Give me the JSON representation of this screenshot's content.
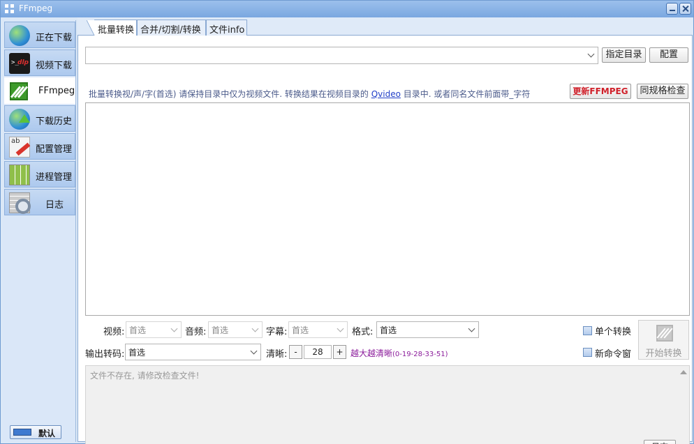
{
  "window": {
    "title": "FFmpeg"
  },
  "sidebar": {
    "items": [
      {
        "label": "正在下载",
        "icon": "globe-link-icon",
        "active": false
      },
      {
        "label": "视频下载",
        "icon": "terminal-dlp-icon",
        "active": false
      },
      {
        "label": "FFmpeg",
        "icon": "ffmpeg-icon",
        "active": true
      },
      {
        "label": "下载历史",
        "icon": "globe-upload-icon",
        "active": false
      },
      {
        "label": "配置管理",
        "icon": "edit-pencil-icon",
        "active": false
      },
      {
        "label": "进程管理",
        "icon": "grid-table-icon",
        "active": false
      },
      {
        "label": "日志",
        "icon": "log-gear-icon",
        "active": false
      }
    ],
    "default_button": "默认"
  },
  "tabs": [
    {
      "label": "批量转换",
      "active": true
    },
    {
      "label": "合并/切割/转换",
      "active": false
    },
    {
      "label": "文件info",
      "active": false
    }
  ],
  "toolbar": {
    "directory_value": "",
    "specify_dir_button": "指定目录",
    "config_button": "配置",
    "update_button": "更新FFMPEG",
    "spec_check_button": "同规格检查"
  },
  "hint": {
    "before": "批量转换视/声/字(首选) 请保持目录中仅为视频文件. 转换结果在视频目录的 ",
    "link": "Qvideo",
    "after": " 目录中. 或者同名文件前面带_字符"
  },
  "options": {
    "video_label": "视频:",
    "video_value": "首选",
    "audio_label": "音频:",
    "audio_value": "首选",
    "subtitle_label": "字幕:",
    "subtitle_value": "首选",
    "format_label": "格式:",
    "format_value": "首选",
    "output_codec_label": "输出转码:",
    "output_codec_value": "首选",
    "clarity_label": "清晰:",
    "clarity_minus": "-",
    "clarity_value": "28",
    "clarity_plus": "+",
    "quality_hint": "越大越清晰",
    "quality_range": "(0-19-28-33-51)",
    "single_convert_label": "单个转换",
    "new_cmd_window_label": "新命令窗",
    "start_button": "开始转换"
  },
  "log": {
    "message": "文件不存在, 请修改检查文件!",
    "log_button": "日志"
  },
  "colors": {
    "accent": "#7aa7e0",
    "update_button_text": "#d0202a",
    "quality_hint": "#8a1a9a"
  }
}
